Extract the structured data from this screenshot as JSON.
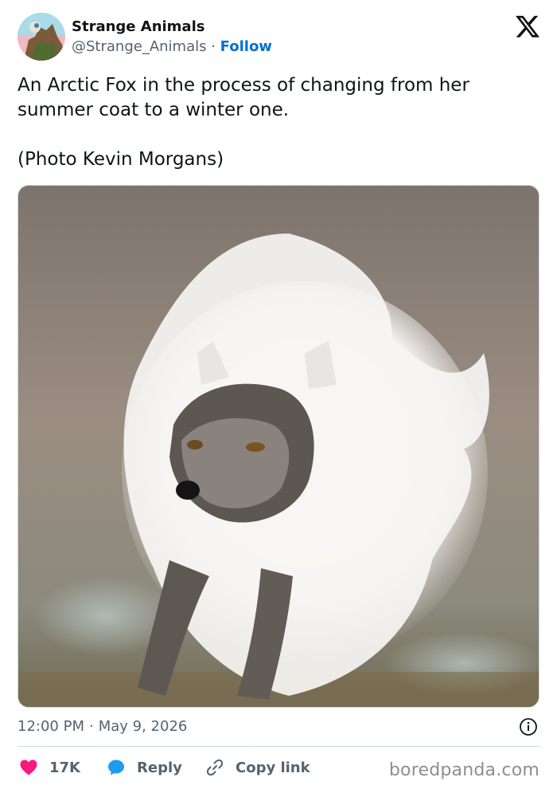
{
  "tweet": {
    "display_name": "Strange Animals",
    "handle": "@Strange_Animals",
    "separator": " · ",
    "follow_label": "Follow",
    "text": "An Arctic Fox in the process of changing from her summer coat to a winter one.\n\n(Photo Kevin Morgans)",
    "time": "12:00 PM",
    "date": "May 9, 2026",
    "meta_separator": "·"
  },
  "actions": {
    "like_count": "17K",
    "reply_label": "Reply",
    "copy_label": "Copy link"
  },
  "watermark": "boredpanda.com",
  "colors": {
    "accent": "#006fd6",
    "like": "#f91880",
    "reply": "#1d9bf0",
    "text": "#0f1419",
    "muted": "#536471"
  },
  "icons": [
    "x-logo-icon",
    "info-icon",
    "heart-icon",
    "speech-bubble-icon",
    "link-icon"
  ]
}
